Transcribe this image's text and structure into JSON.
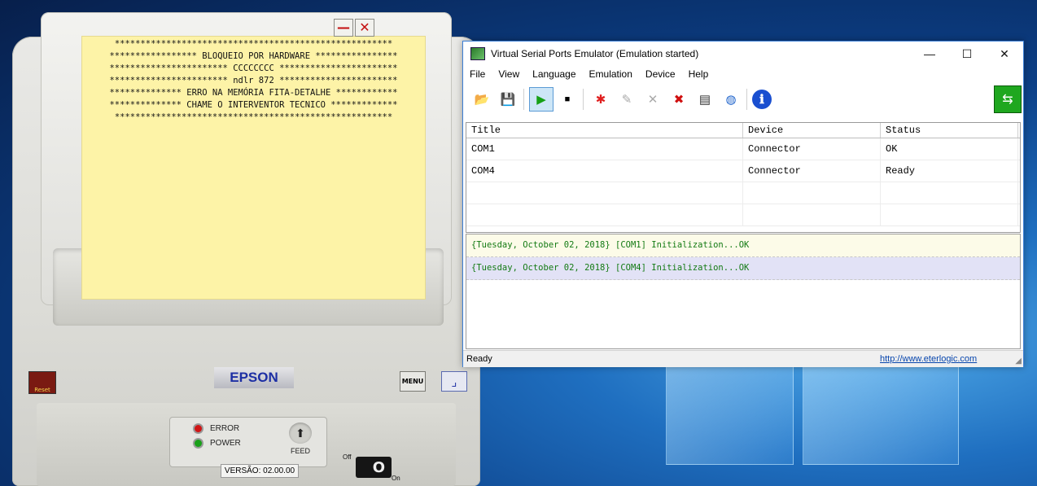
{
  "printer": {
    "paper_lines": [
      "******************************************************",
      "***************** BLOQUEIO POR HARDWARE ****************",
      "*********************** CCCCCCCC ***********************",
      "*********************** ndlr 872 ***********************",
      "************** ERRO NA MEMÓRIA FITA-DETALHE ************",
      "************** CHAME O INTERVENTOR TECNICO *************",
      "******************************************************"
    ],
    "minimize_glyph": "—",
    "close_glyph": "✕",
    "reset_label": "Reset",
    "brand": "EPSON",
    "menu_label": "MENU",
    "corner_glyph": "⌟",
    "error_label": "ERROR",
    "power_label": "POWER",
    "feed_label": "FEED",
    "feed_glyph": "⬆",
    "version": "VERSÃO: 02.00.00",
    "switch_off": "Off",
    "switch_on": "On",
    "switch_glyph": "O",
    "colors": {
      "error_led": "#d01414",
      "power_led": "#19a019"
    }
  },
  "vspe": {
    "title": "Virtual Serial Ports Emulator (Emulation started)",
    "controls": {
      "minimize": "—",
      "maximize": "☐",
      "close": "✕"
    },
    "menu": [
      "File",
      "View",
      "Language",
      "Emulation",
      "Device",
      "Help"
    ],
    "toolbar": {
      "open": "📂",
      "save": "💾",
      "play": "▶",
      "stop": "■",
      "add_device": "✱",
      "edit_device": "✎",
      "remove_device": "✕",
      "delete_device": "✖",
      "properties": "▤",
      "web": "◍",
      "info": "ℹ",
      "logo": "⇆"
    },
    "grid": {
      "headers": [
        "Title",
        "Device",
        "Status"
      ],
      "rows": [
        [
          "COM1",
          "Connector",
          "OK"
        ],
        [
          "COM4",
          "Connector",
          "Ready"
        ],
        [
          "",
          "",
          ""
        ],
        [
          "",
          "",
          ""
        ]
      ]
    },
    "log": [
      "{Tuesday, October 02, 2018} [COM1] Initialization...OK",
      "{Tuesday, October 02, 2018} [COM4] Initialization...OK"
    ],
    "status": "Ready",
    "link": "http://www.eterlogic.com"
  }
}
